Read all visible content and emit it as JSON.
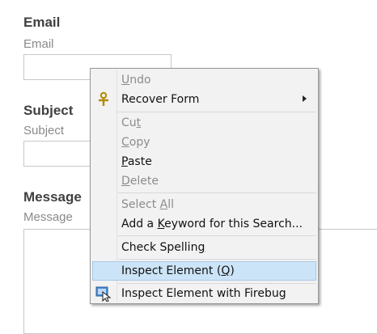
{
  "form": {
    "email": {
      "title": "Email",
      "caption": "Email"
    },
    "subject": {
      "title": "Subject",
      "caption": "Subject"
    },
    "message": {
      "title": "Message",
      "caption": "Message"
    }
  },
  "context_menu": {
    "items": [
      {
        "pre": "",
        "key": "U",
        "post": "ndo",
        "enabled": false
      },
      {
        "pre": "Recover Form",
        "key": "",
        "post": "",
        "enabled": true,
        "submenu": true,
        "icon": "recover-form-icon"
      },
      {
        "pre": "Cu",
        "key": "t",
        "post": "",
        "enabled": false
      },
      {
        "pre": "",
        "key": "C",
        "post": "opy",
        "enabled": false
      },
      {
        "pre": "",
        "key": "P",
        "post": "aste",
        "enabled": true
      },
      {
        "pre": "",
        "key": "D",
        "post": "elete",
        "enabled": false
      },
      {
        "pre": "Select ",
        "key": "A",
        "post": "ll",
        "enabled": false
      },
      {
        "pre": "Add a ",
        "key": "K",
        "post": "eyword for this Search...",
        "enabled": true
      },
      {
        "pre": "Check Spellin",
        "key": "g",
        "post": "",
        "enabled": true
      },
      {
        "pre": "Inspect Element (",
        "key": "Q",
        "post": ")",
        "enabled": true,
        "highlighted": true
      },
      {
        "pre": "Inspect Element with Firebug",
        "key": "",
        "post": "",
        "enabled": true,
        "icon": "firebug-inspect-icon"
      }
    ]
  },
  "colors": {
    "highlight_bg": "#cce4f7",
    "menu_bg": "#f2f2f2",
    "disabled_text": "#8c8c8c"
  }
}
